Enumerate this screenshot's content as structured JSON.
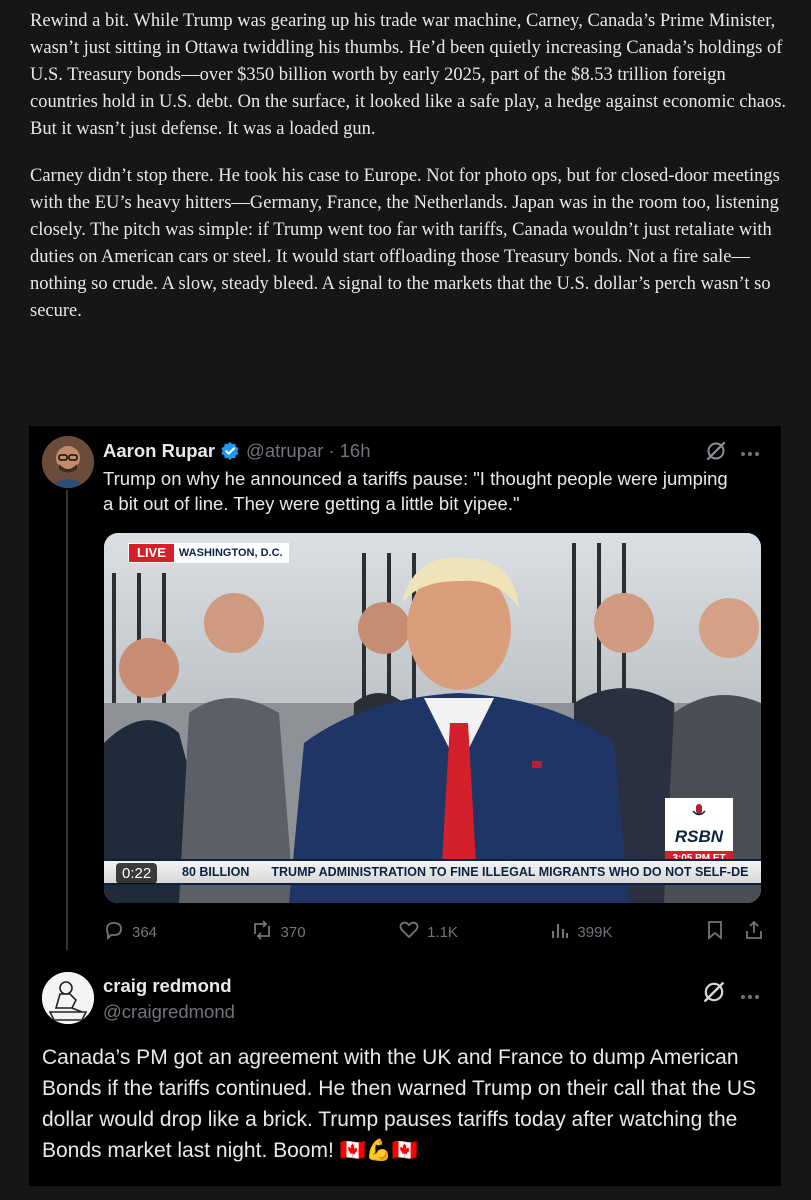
{
  "article": {
    "paragraph1": "Rewind a bit. While Trump was gearing up his trade war machine, Carney, Canada’s Prime Minister, wasn’t just sitting in Ottawa twiddling his thumbs. He’d been quietly increasing Canada’s holdings of U.S. Treasury bonds—over $350 billion worth by early 2025, part of the $8.53 trillion foreign countries hold in U.S. debt. On the surface, it looked like a safe play, a hedge against economic chaos. But it wasn’t just defense. It was a loaded gun.",
    "paragraph2": "Carney didn’t stop there. He took his case to Europe. Not for photo ops, but for closed-door meetings with the EU’s heavy hitters—Germany, France, the Netherlands. Japan was in the room too, listening closely. The pitch was simple: if Trump went too far with tariffs, Canada wouldn’t just retaliate with duties on American cars or steel. It would start offloading those Treasury bonds. Not a fire sale—nothing so crude. A slow, steady bleed. A signal to the markets that the U.S. dollar’s perch wasn’t so secure."
  },
  "tweet1": {
    "display_name": "Aaron Rupar",
    "handle": "@atrupar",
    "separator": "·",
    "time": "16h",
    "text": "Trump on why he announced a tariffs pause: \"I thought people were jumping a bit out of line. They were getting a little bit yipee.\"",
    "video": {
      "live_label": "LIVE",
      "location": "WASHINGTON, D.C.",
      "logo": "RSBN",
      "time_badge": "3:05 PM ET",
      "duration": "0:22",
      "ticker_left": "80 BILLION",
      "ticker_right": "TRUMP ADMINISTRATION TO FINE ILLEGAL MIGRANTS WHO DO NOT SELF-DE"
    },
    "replies": "364",
    "reposts": "370",
    "likes": "1.1K",
    "views": "399K"
  },
  "tweet2": {
    "display_name": "craig redmond",
    "handle": "@craigredmond",
    "text": "Canada’s PM got an agreement with the UK and France to dump American Bonds if the tariffs continued. He then warned Trump on their call that the US dollar would drop like a brick. Trump pauses tariffs today after watching the Bonds market last night. Boom! 🇨🇦💪🇨🇦"
  },
  "colors": {
    "verified_blue": "#1d9bf0",
    "live_red": "#d4202a",
    "muted": "#71767b"
  }
}
